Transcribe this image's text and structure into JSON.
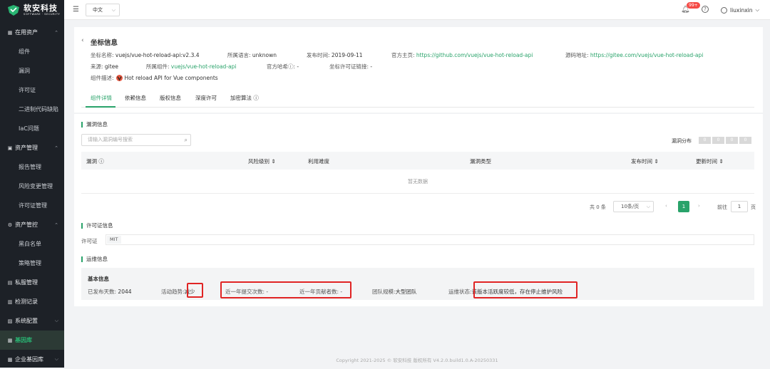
{
  "brand": {
    "name": "软安科技",
    "sub": "SOFTWARE · SECURITY"
  },
  "sidebar": {
    "groups": [
      {
        "label": "在用资产",
        "icon": "asset-icon",
        "items": [
          "组件",
          "漏洞",
          "许可证",
          "二进制代码缺陷",
          "IaC问题"
        ]
      },
      {
        "label": "资产管理",
        "icon": "box-icon",
        "items": [
          "报告管理",
          "风险变更管理",
          "许可证管理"
        ]
      },
      {
        "label": "资产管控",
        "icon": "gear-icon",
        "items": [
          "黑白名单",
          "策略管理"
        ]
      }
    ],
    "singles": [
      {
        "label": "私服管理",
        "icon": "server-icon"
      },
      {
        "label": "检测记录",
        "icon": "record-icon"
      },
      {
        "label": "系统配置",
        "icon": "settings-icon"
      },
      {
        "label": "基因库",
        "icon": "gene-icon",
        "active": true
      },
      {
        "label": "企业基因库",
        "icon": "gene-icon"
      }
    ]
  },
  "topbar": {
    "language": "中文",
    "badge": "99+",
    "username": "liuxinxin"
  },
  "detail": {
    "title": "坐标信息",
    "coord_label": "坐标名称:",
    "coord": "vuejs/vue-hot-reload-api:v2.3.4",
    "lang_label": "所属语言:",
    "lang": "unknown",
    "date_label": "发布时间:",
    "date": "2019-09-11",
    "home_label": "官方主页:",
    "home": "https://github.com/vuejs/vue-hot-reload-api",
    "src_label": "源码地址:",
    "src": "https://gitee.com/vuejs/vue-hot-reload-api",
    "from_label": "来源:",
    "from": "gitee",
    "comp_label": "所属组件:",
    "comp": "vuejs/vue-hot-reload-api",
    "sig_label": "官方哈希ⓘ:",
    "sig": "-",
    "lic_label": "坐标许可证链接:",
    "lic": "-",
    "desc_label": "组件描述:",
    "desc": "Hot reload API for Vue components"
  },
  "tabs": [
    "组件详情",
    "依赖信息",
    "版权信息",
    "深度许可",
    "加密算法 ⓘ"
  ],
  "vuln": {
    "title": "漏洞信息",
    "search_placeholder": "请输入漏洞编号搜索",
    "dist_label": "漏洞分布",
    "dist": [
      "0",
      "0",
      "0",
      "0"
    ],
    "columns": [
      "漏洞 ⓘ",
      "风险级别 ⇕",
      "利用难度",
      "漏洞类型",
      "发布时间 ⇕",
      "更新时间 ⇕"
    ],
    "empty": "暂无数据",
    "total": "共 0 条",
    "per_page": "10条/页",
    "page": "1",
    "goto": "前往",
    "goto_val": "1",
    "page_unit": "页"
  },
  "license": {
    "title": "许可证信息",
    "label": "许可证",
    "value": "MIT"
  },
  "ops": {
    "title": "运维信息",
    "sub": "基本信息",
    "days_label": "已发布天数:",
    "days": "2044",
    "trend_label": "活动趋势:",
    "trend": "减少",
    "commits_label": "近一年提交次数:",
    "commits": "-",
    "contrib_label": "近一年贡献者数:",
    "contrib": "-",
    "team_label": "团队规模:",
    "team": "大型团队",
    "status_label": "运维状态:",
    "status": "该版本活跃度较低，存在停止维护风险"
  },
  "footer": "Copyright 2021-2025 © 软安科技 版权所有 V4.2.0.build1.0.A-20250331",
  "colors": {
    "accent": "#29a36a",
    "highlight": "#e02424",
    "sidebar": "#1d2127"
  }
}
